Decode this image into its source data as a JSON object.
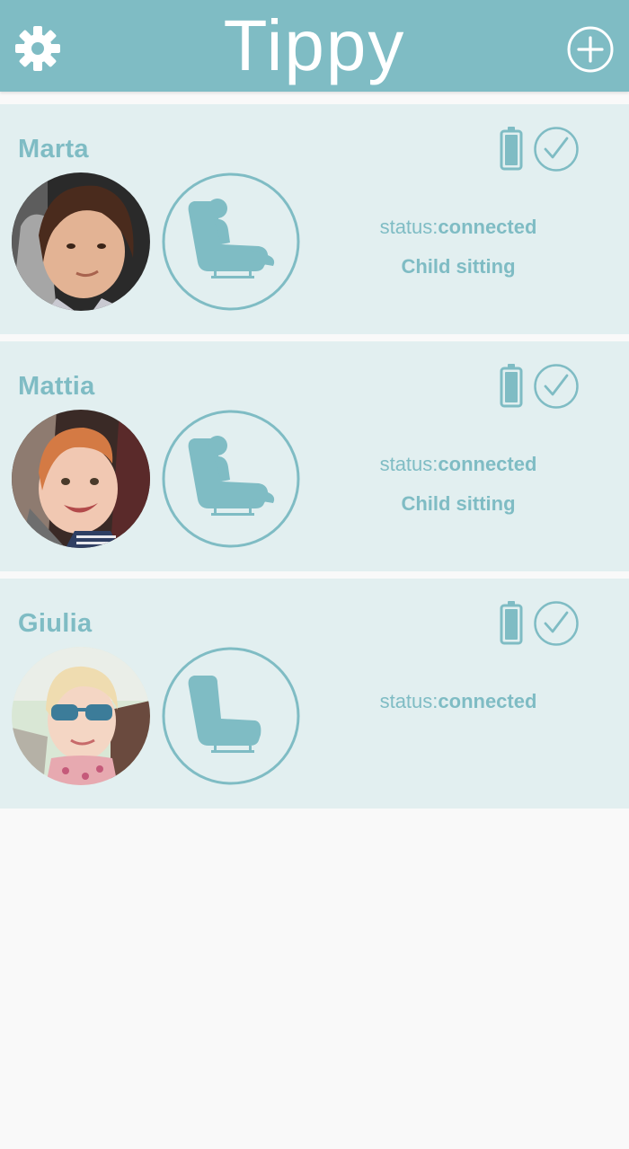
{
  "app": {
    "title": "Tippy",
    "accent_color": "#7fbcc4",
    "card_bg_color": "#e2eff0"
  },
  "header": {
    "settings_icon": "gear-icon",
    "add_icon": "plus-circle-icon"
  },
  "children": [
    {
      "name": "Marta",
      "status_label": "status:",
      "status_value": "connected",
      "seat_state": "Child sitting",
      "seat_icon": "car-seat-occupied-icon",
      "battery_icon": "battery-full-icon",
      "check_icon": "check-circle-icon"
    },
    {
      "name": "Mattia",
      "status_label": "status:",
      "status_value": "connected",
      "seat_state": "Child sitting",
      "seat_icon": "car-seat-occupied-icon",
      "battery_icon": "battery-full-icon",
      "check_icon": "check-circle-icon"
    },
    {
      "name": "Giulia",
      "status_label": "status:",
      "status_value": "connected",
      "seat_state": "",
      "seat_icon": "car-seat-empty-icon",
      "battery_icon": "battery-full-icon",
      "check_icon": "check-circle-icon"
    }
  ]
}
